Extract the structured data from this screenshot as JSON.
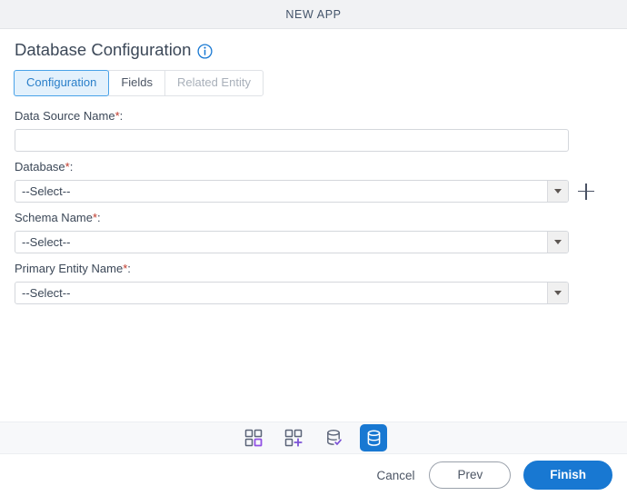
{
  "window": {
    "title": "NEW APP"
  },
  "page": {
    "title": "Database Configuration",
    "info_icon": "info-circle-icon"
  },
  "tabs": [
    {
      "label": "Configuration",
      "state": "active"
    },
    {
      "label": "Fields",
      "state": "default"
    },
    {
      "label": "Related Entity",
      "state": "disabled"
    }
  ],
  "form": {
    "fields": [
      {
        "label": "Data Source Name",
        "required_mark": "*",
        "colon": ":",
        "type": "text",
        "value": "",
        "placeholder": ""
      },
      {
        "label": "Database",
        "required_mark": "*",
        "colon": ":",
        "type": "select",
        "value": "--Select--",
        "has_add_button": true,
        "add_button_icon": "plus-icon"
      },
      {
        "label": "Schema Name",
        "required_mark": "*",
        "colon": ":",
        "type": "select",
        "value": "--Select--",
        "has_add_button": false
      },
      {
        "label": "Primary Entity Name",
        "required_mark": "*",
        "colon": ":",
        "type": "select",
        "value": "--Select--",
        "has_add_button": false
      }
    ]
  },
  "stepper": {
    "steps": [
      {
        "icon": "grid-four-squares-icon",
        "state": "done",
        "accent": "#9150e4"
      },
      {
        "icon": "grid-add-squares-icon",
        "state": "done",
        "accent": "#7b52d6"
      },
      {
        "icon": "database-check-icon",
        "state": "done",
        "accent": "#7b52d6"
      },
      {
        "icon": "database-icon",
        "state": "active",
        "accent": "#ffffff"
      }
    ]
  },
  "footer": {
    "cancel_label": "Cancel",
    "prev_label": "Prev",
    "finish_label": "Finish"
  },
  "colors": {
    "primary_blue": "#1878d2",
    "tab_active_bg": "#e3f1fc",
    "tab_active_border": "#49a2e8",
    "tab_active_text": "#2a7fc9",
    "header_bg": "#f1f2f4",
    "stepper_bg": "#f7f8fa",
    "required_red": "#c0392b",
    "label_text": "#3c4858",
    "purple_accent": "#9150e4"
  }
}
